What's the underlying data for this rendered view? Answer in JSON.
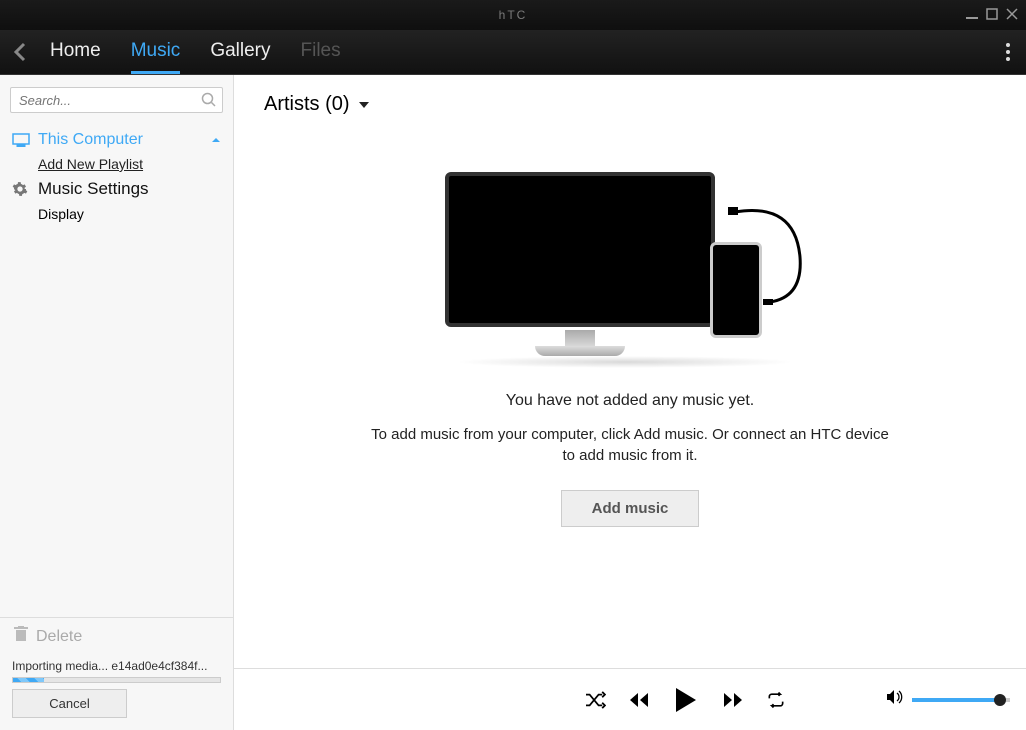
{
  "app": {
    "title": "hTC"
  },
  "window": {
    "min": "_",
    "max": "▢",
    "close": "✕"
  },
  "nav": {
    "tabs": [
      {
        "label": "Home"
      },
      {
        "label": "Music"
      },
      {
        "label": "Gallery"
      },
      {
        "label": "Files"
      }
    ]
  },
  "sidebar": {
    "search_placeholder": "Search...",
    "this_computer": "This Computer",
    "add_playlist": "Add New Playlist",
    "music_settings": "Music Settings",
    "display": "Display",
    "delete": "Delete",
    "import_status": "Importing media... e14ad0e4cf384f...",
    "cancel": "Cancel"
  },
  "main": {
    "heading": "Artists (0)",
    "empty_line1": "You have not added any music yet.",
    "empty_line2": "To add music from your computer, click Add music. Or connect an HTC device to add music from it.",
    "add_music": "Add music"
  }
}
